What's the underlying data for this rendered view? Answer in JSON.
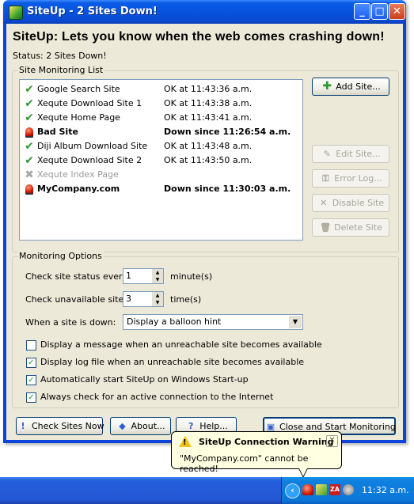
{
  "window": {
    "title": "SiteUp - 2 Sites Down!",
    "controls": {
      "minimize": "_",
      "maximize": "□",
      "close": "✕"
    }
  },
  "header": {
    "headline": "SiteUp: Lets you know when the web comes crashing down!",
    "status": "Status: 2 Sites Down!"
  },
  "site_list": {
    "group_label": "Site Monitoring List",
    "rows": [
      {
        "name": "Google Search Site",
        "status": "OK at 11:43:36 a.m.",
        "state": "ok"
      },
      {
        "name": "Xequte Download Site 1",
        "status": "OK at 11:43:38 a.m.",
        "state": "ok"
      },
      {
        "name": "Xequte Home Page",
        "status": "OK at 11:43:41 a.m.",
        "state": "ok"
      },
      {
        "name": "Bad Site",
        "status": "Down since 11:26:54 a.m.",
        "state": "down"
      },
      {
        "name": "Diji Album Download Site",
        "status": "OK at 11:43:48 a.m.",
        "state": "ok"
      },
      {
        "name": "Xequte Download Site 2",
        "status": "OK at 11:43:50 a.m.",
        "state": "ok"
      },
      {
        "name": "Xequte Index Page",
        "status": "",
        "state": "disabled"
      },
      {
        "name": "MyCompany.com",
        "status": "Down since 11:30:03 a.m.",
        "state": "down"
      }
    ],
    "buttons": {
      "add": "Add Site...",
      "edit": "Edit Site...",
      "error_log": "Error Log...",
      "disable": "Disable Site",
      "delete": "Delete Site"
    }
  },
  "monitoring": {
    "group_label": "Monitoring Options",
    "check_every_label": "Check site status every",
    "check_every_value": "1",
    "check_every_unit": "minute(s)",
    "unavailable_label": "Check unavailable sites",
    "unavailable_value": "3",
    "unavailable_unit": "time(s)",
    "when_down_label": "When a site is down:",
    "when_down_value": "Display a balloon hint",
    "options": [
      {
        "label": "Display a message when an unreachable site becomes available",
        "checked": false
      },
      {
        "label": "Display log file when an unreachable site becomes available",
        "checked": true
      },
      {
        "label": "Automatically start SiteUp on Windows Start-up",
        "checked": true
      },
      {
        "label": "Always check for an active connection to the Internet",
        "checked": true
      }
    ]
  },
  "bottom_buttons": {
    "check_now": "Check Sites Now",
    "about": "About...",
    "help": "Help...",
    "close_start": "Close and Start Monitoring"
  },
  "balloon": {
    "title": "SiteUp Connection Warning",
    "message": "\"MyCompany.com\" cannot be reached!"
  },
  "taskbar": {
    "clock": "11:32 a.m."
  },
  "colors": {
    "ok": "#2e9a2e",
    "titlebar": "#0653e0",
    "dialog_bg": "#ece9d8",
    "balloon_bg": "#ffffe1"
  }
}
